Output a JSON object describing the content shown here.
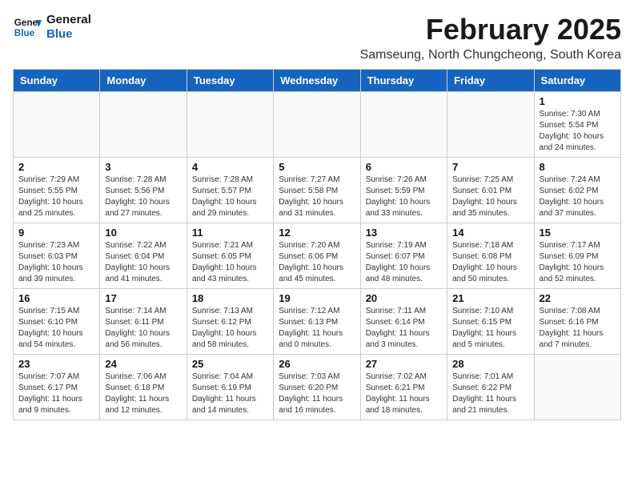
{
  "header": {
    "logo_line1": "General",
    "logo_line2": "Blue",
    "month": "February 2025",
    "location": "Samseung, North Chungcheong, South Korea"
  },
  "weekdays": [
    "Sunday",
    "Monday",
    "Tuesday",
    "Wednesday",
    "Thursday",
    "Friday",
    "Saturday"
  ],
  "weeks": [
    [
      {
        "day": "",
        "info": ""
      },
      {
        "day": "",
        "info": ""
      },
      {
        "day": "",
        "info": ""
      },
      {
        "day": "",
        "info": ""
      },
      {
        "day": "",
        "info": ""
      },
      {
        "day": "",
        "info": ""
      },
      {
        "day": "1",
        "info": "Sunrise: 7:30 AM\nSunset: 5:54 PM\nDaylight: 10 hours and 24 minutes."
      }
    ],
    [
      {
        "day": "2",
        "info": "Sunrise: 7:29 AM\nSunset: 5:55 PM\nDaylight: 10 hours and 25 minutes."
      },
      {
        "day": "3",
        "info": "Sunrise: 7:28 AM\nSunset: 5:56 PM\nDaylight: 10 hours and 27 minutes."
      },
      {
        "day": "4",
        "info": "Sunrise: 7:28 AM\nSunset: 5:57 PM\nDaylight: 10 hours and 29 minutes."
      },
      {
        "day": "5",
        "info": "Sunrise: 7:27 AM\nSunset: 5:58 PM\nDaylight: 10 hours and 31 minutes."
      },
      {
        "day": "6",
        "info": "Sunrise: 7:26 AM\nSunset: 5:59 PM\nDaylight: 10 hours and 33 minutes."
      },
      {
        "day": "7",
        "info": "Sunrise: 7:25 AM\nSunset: 6:01 PM\nDaylight: 10 hours and 35 minutes."
      },
      {
        "day": "8",
        "info": "Sunrise: 7:24 AM\nSunset: 6:02 PM\nDaylight: 10 hours and 37 minutes."
      }
    ],
    [
      {
        "day": "9",
        "info": "Sunrise: 7:23 AM\nSunset: 6:03 PM\nDaylight: 10 hours and 39 minutes."
      },
      {
        "day": "10",
        "info": "Sunrise: 7:22 AM\nSunset: 6:04 PM\nDaylight: 10 hours and 41 minutes."
      },
      {
        "day": "11",
        "info": "Sunrise: 7:21 AM\nSunset: 6:05 PM\nDaylight: 10 hours and 43 minutes."
      },
      {
        "day": "12",
        "info": "Sunrise: 7:20 AM\nSunset: 6:06 PM\nDaylight: 10 hours and 45 minutes."
      },
      {
        "day": "13",
        "info": "Sunrise: 7:19 AM\nSunset: 6:07 PM\nDaylight: 10 hours and 48 minutes."
      },
      {
        "day": "14",
        "info": "Sunrise: 7:18 AM\nSunset: 6:08 PM\nDaylight: 10 hours and 50 minutes."
      },
      {
        "day": "15",
        "info": "Sunrise: 7:17 AM\nSunset: 6:09 PM\nDaylight: 10 hours and 52 minutes."
      }
    ],
    [
      {
        "day": "16",
        "info": "Sunrise: 7:15 AM\nSunset: 6:10 PM\nDaylight: 10 hours and 54 minutes."
      },
      {
        "day": "17",
        "info": "Sunrise: 7:14 AM\nSunset: 6:11 PM\nDaylight: 10 hours and 56 minutes."
      },
      {
        "day": "18",
        "info": "Sunrise: 7:13 AM\nSunset: 6:12 PM\nDaylight: 10 hours and 58 minutes."
      },
      {
        "day": "19",
        "info": "Sunrise: 7:12 AM\nSunset: 6:13 PM\nDaylight: 11 hours and 0 minutes."
      },
      {
        "day": "20",
        "info": "Sunrise: 7:11 AM\nSunset: 6:14 PM\nDaylight: 11 hours and 3 minutes."
      },
      {
        "day": "21",
        "info": "Sunrise: 7:10 AM\nSunset: 6:15 PM\nDaylight: 11 hours and 5 minutes."
      },
      {
        "day": "22",
        "info": "Sunrise: 7:08 AM\nSunset: 6:16 PM\nDaylight: 11 hours and 7 minutes."
      }
    ],
    [
      {
        "day": "23",
        "info": "Sunrise: 7:07 AM\nSunset: 6:17 PM\nDaylight: 11 hours and 9 minutes."
      },
      {
        "day": "24",
        "info": "Sunrise: 7:06 AM\nSunset: 6:18 PM\nDaylight: 11 hours and 12 minutes."
      },
      {
        "day": "25",
        "info": "Sunrise: 7:04 AM\nSunset: 6:19 PM\nDaylight: 11 hours and 14 minutes."
      },
      {
        "day": "26",
        "info": "Sunrise: 7:03 AM\nSunset: 6:20 PM\nDaylight: 11 hours and 16 minutes."
      },
      {
        "day": "27",
        "info": "Sunrise: 7:02 AM\nSunset: 6:21 PM\nDaylight: 11 hours and 18 minutes."
      },
      {
        "day": "28",
        "info": "Sunrise: 7:01 AM\nSunset: 6:22 PM\nDaylight: 11 hours and 21 minutes."
      },
      {
        "day": "",
        "info": ""
      }
    ]
  ]
}
